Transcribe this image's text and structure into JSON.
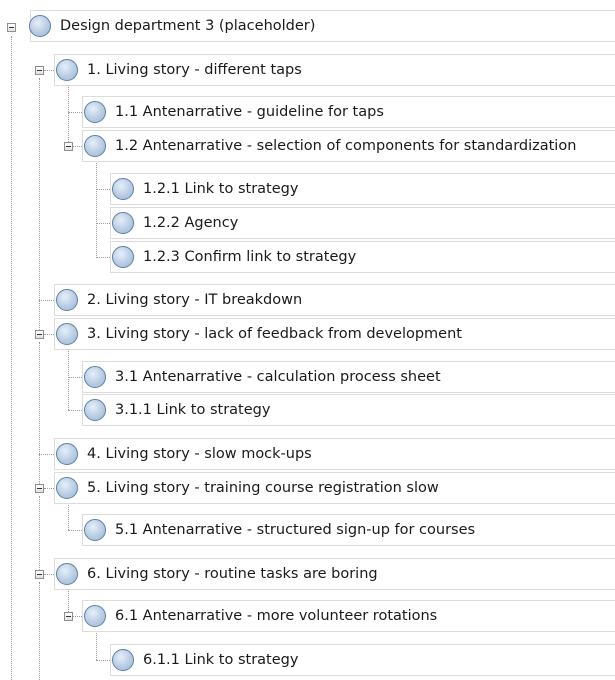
{
  "tree": {
    "root": {
      "label": "Design department 3 (placeholder)",
      "expanded": true
    },
    "items": [
      {
        "id": "ls1",
        "label": "1. Living story - different taps",
        "expanded": true
      },
      {
        "id": "a1_1",
        "label": "1.1 Antenarrative - guideline for taps"
      },
      {
        "id": "a1_2",
        "label": "1.2 Antenarrative - selection of components for standardization",
        "expanded": true
      },
      {
        "id": "l1_2_1",
        "label": "1.2.1 Link to strategy"
      },
      {
        "id": "l1_2_2",
        "label": "1.2.2 Agency"
      },
      {
        "id": "l1_2_3",
        "label": "1.2.3 Confirm link to strategy"
      },
      {
        "id": "ls2",
        "label": "2. Living story - IT breakdown"
      },
      {
        "id": "ls3",
        "label": "3. Living story - lack of feedback from development",
        "expanded": true
      },
      {
        "id": "a3_1",
        "label": "3.1 Antenarrative - calculation process sheet"
      },
      {
        "id": "l3_1_1",
        "label": "3.1.1 Link to strategy"
      },
      {
        "id": "ls4",
        "label": "4. Living story - slow mock-ups"
      },
      {
        "id": "ls5",
        "label": "5. Living story - training course registration slow",
        "expanded": true
      },
      {
        "id": "a5_1",
        "label": "5.1 Antenarrative - structured sign-up for courses"
      },
      {
        "id": "ls6",
        "label": "6. Living story - routine tasks are boring",
        "expanded": true
      },
      {
        "id": "a6_1",
        "label": "6.1 Antenarrative - more volunteer rotations",
        "expanded": true
      },
      {
        "id": "l6_1_1",
        "label": "6.1.1 Link to strategy"
      }
    ]
  }
}
